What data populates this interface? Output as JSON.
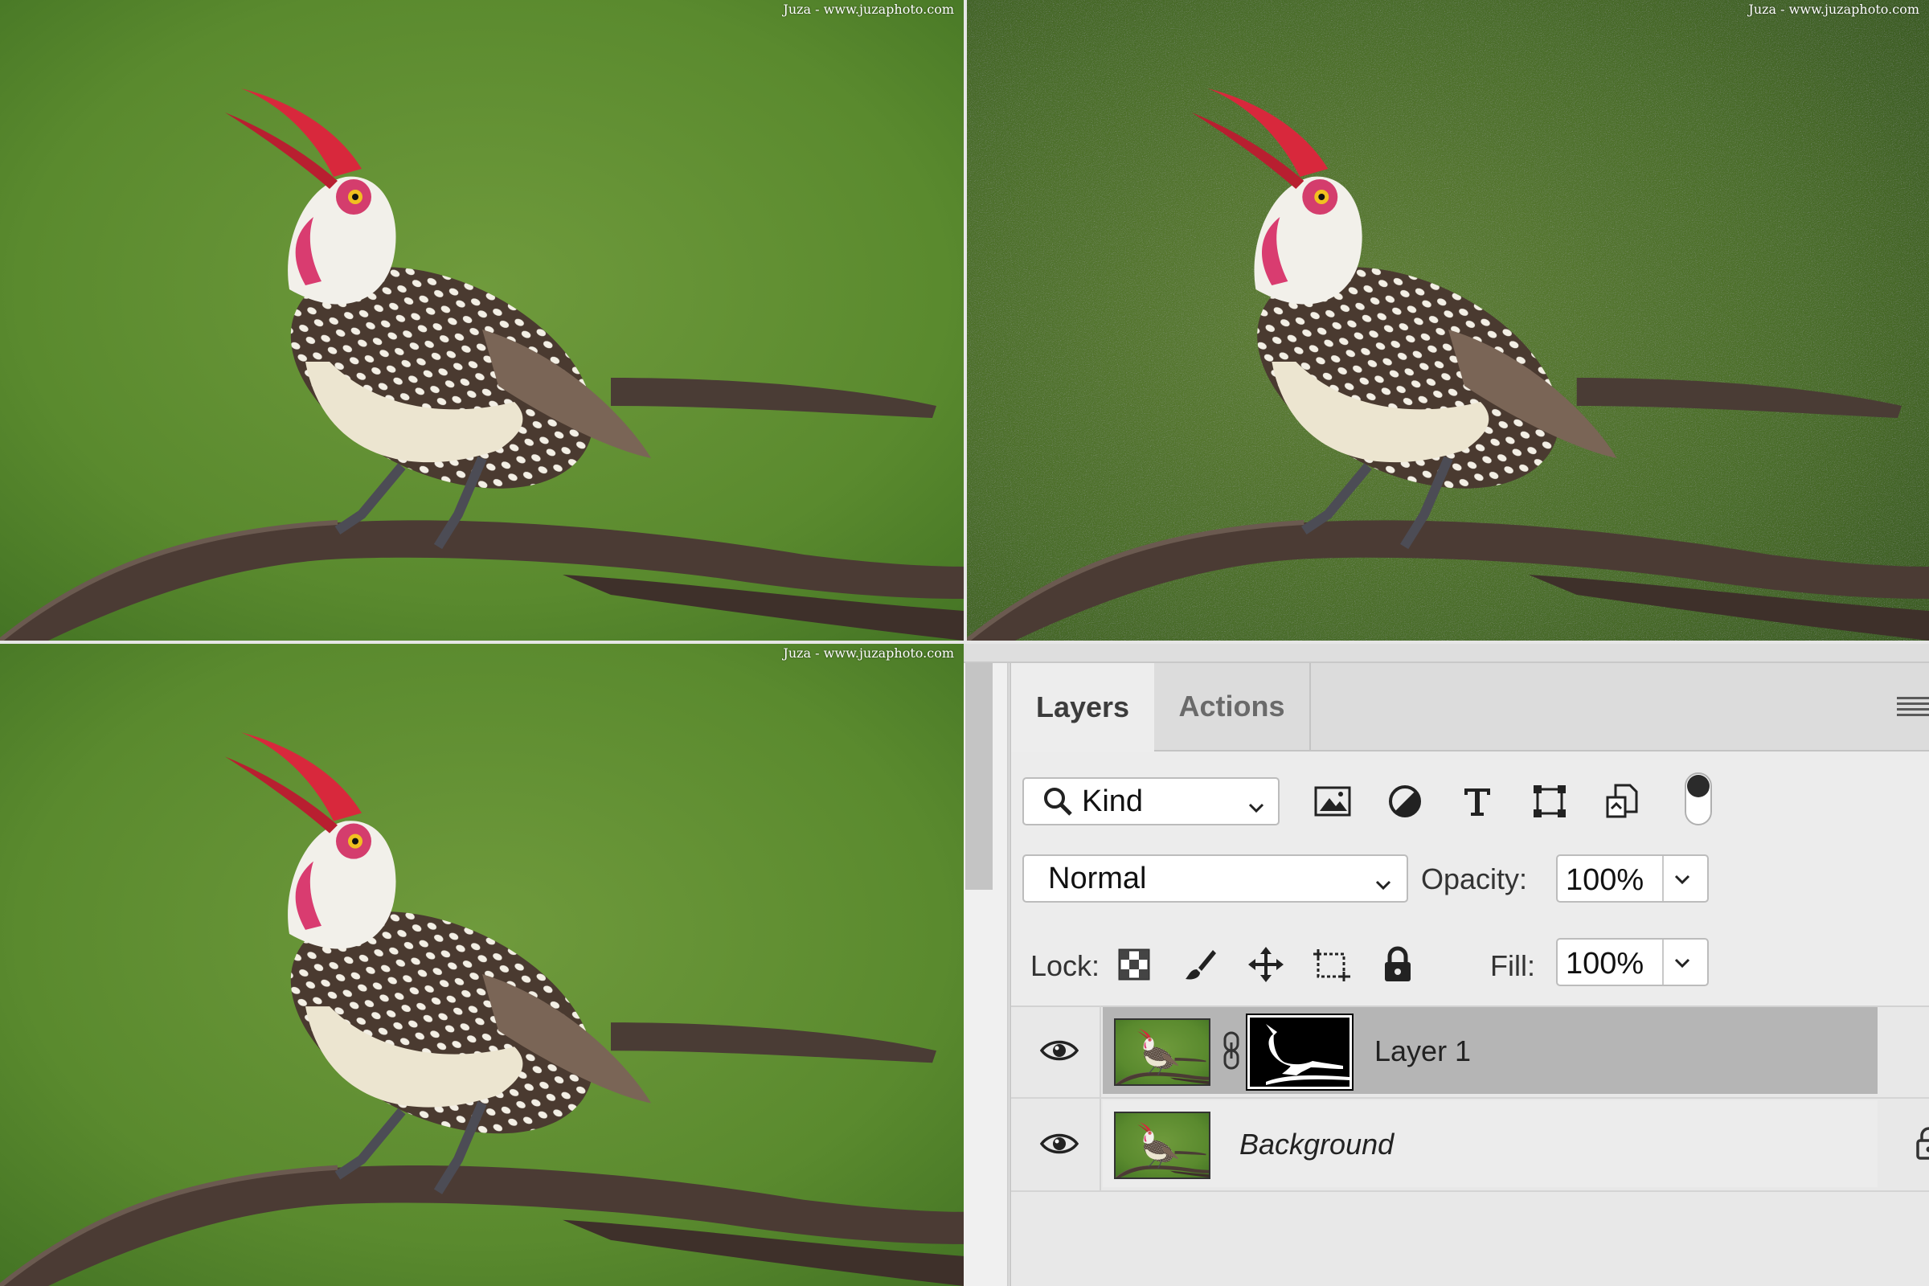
{
  "watermark": "Juza - www.juzaphoto.com",
  "photos": {
    "top_left": "original",
    "top_right": "noisy-background",
    "bottom_left": "masked-result"
  },
  "panel": {
    "tabs": [
      {
        "label": "Layers",
        "active": true
      },
      {
        "label": "Actions",
        "active": false
      }
    ],
    "menu_icon": "hamburger-menu-icon",
    "filter": {
      "kind_label": "Kind",
      "icons": [
        "image-filter-icon",
        "adjustment-filter-icon",
        "type-filter-icon",
        "shape-filter-icon",
        "smart-object-filter-icon"
      ]
    },
    "blend_mode": "Normal",
    "opacity_label": "Opacity:",
    "opacity_value": "100%",
    "lock_label": "Lock:",
    "lock_icons": [
      "lock-transparent-pixels-icon",
      "lock-image-pixels-icon",
      "lock-position-icon",
      "lock-artboard-icon",
      "lock-all-icon"
    ],
    "fill_label": "Fill:",
    "fill_value": "100%",
    "layers": [
      {
        "name": "Layer 1",
        "selected": true,
        "visible": true,
        "has_mask": true
      },
      {
        "name": "Background",
        "selected": false,
        "visible": true,
        "locked": true
      }
    ]
  },
  "colors": {
    "panel_bg": "#e8e8e8",
    "selected_layer": "#b5b5b5",
    "background_green": "#5e8a30"
  }
}
